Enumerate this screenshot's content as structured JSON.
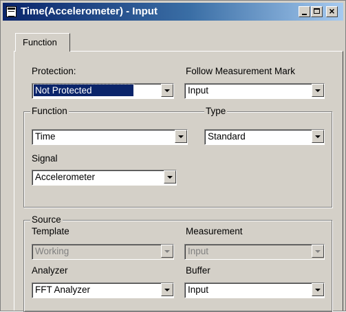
{
  "window": {
    "title": "Time(Accelerometer) - Input"
  },
  "tabs": [
    {
      "label": "Function"
    }
  ],
  "protection": {
    "label": "Protection:",
    "value": "Not Protected"
  },
  "follow": {
    "label": "Follow Measurement Mark",
    "value": "Input"
  },
  "function_group": {
    "title": "Function",
    "function_value": "Time",
    "signal_label": "Signal",
    "signal_value": "Accelerometer"
  },
  "type_group": {
    "title": "Type",
    "value": "Standard"
  },
  "source_group": {
    "title": "Source",
    "template_label": "Template",
    "template_value": "Working",
    "measurement_label": "Measurement",
    "measurement_value": "Input",
    "analyzer_label": "Analyzer",
    "analyzer_value": "FFT Analyzer",
    "buffer_label": "Buffer",
    "buffer_value": "Input"
  },
  "icons": [
    "app-icon",
    "minimize-icon",
    "maximize-icon",
    "close-icon",
    "chevron-down-icon"
  ]
}
